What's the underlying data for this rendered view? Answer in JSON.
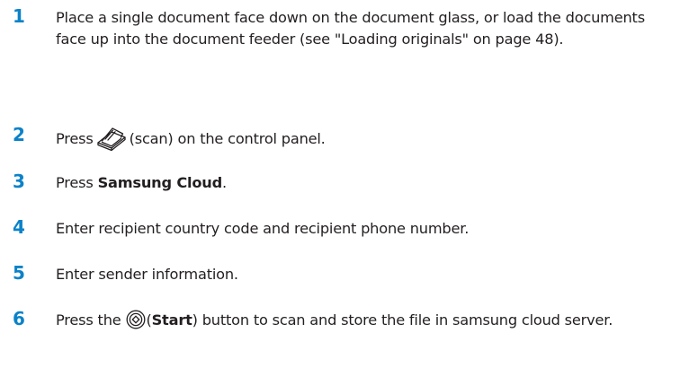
{
  "steps": [
    {
      "number": "1",
      "text": "Place a single document face down on the document glass, or load the documents face up into the document feeder (see \"Loading originals\" on page 48)."
    },
    {
      "number": "2",
      "text_before": "Press",
      "icon": "scan-icon",
      "text_after": "(scan) on the control panel."
    },
    {
      "number": "3",
      "text_before": "Press ",
      "bold": "Samsung Cloud",
      "text_after": "."
    },
    {
      "number": "4",
      "text": "Enter recipient country code and recipient phone number."
    },
    {
      "number": "5",
      "text": "Enter sender information."
    },
    {
      "number": "6",
      "text_before": "Press the",
      "icon": "start-icon",
      "paren_open": "(",
      "bold": "Start",
      "text_after": ") button to scan and store the file in samsung cloud server."
    }
  ],
  "colors": {
    "step_number": "#0b82c8",
    "text": "#231f20"
  }
}
